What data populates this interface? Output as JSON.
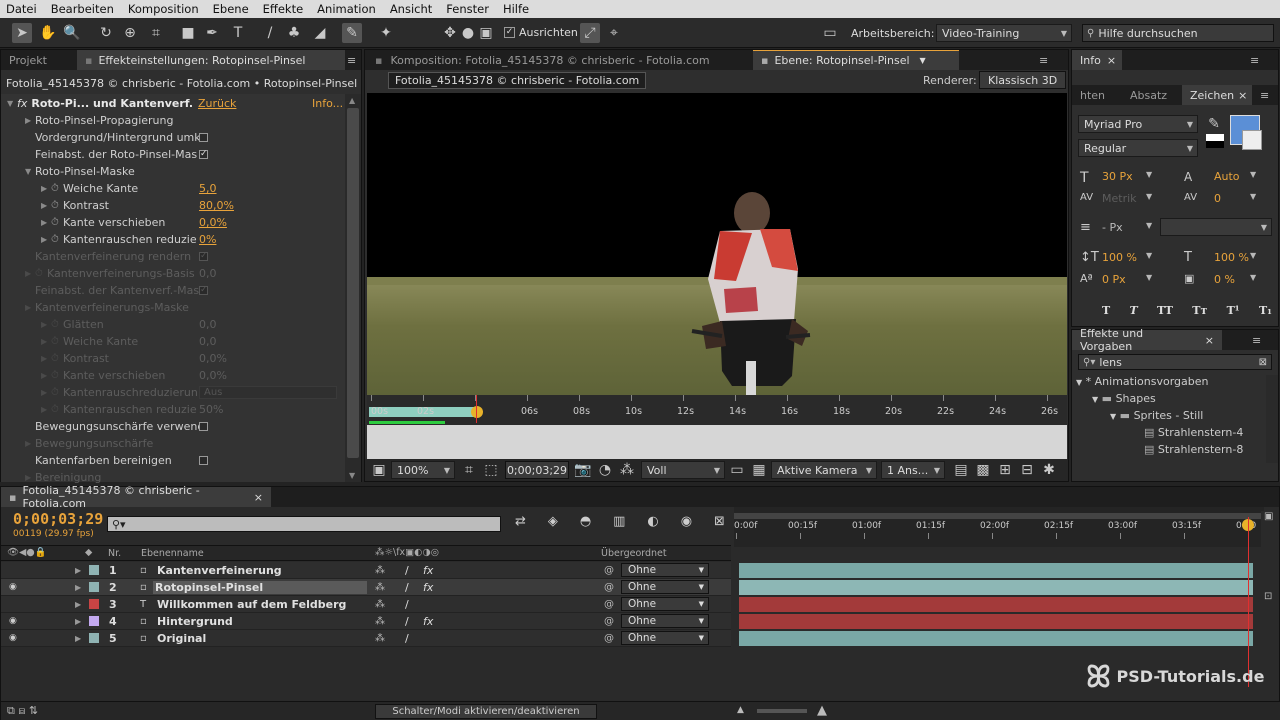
{
  "menu": [
    "Datei",
    "Bearbeiten",
    "Komposition",
    "Ebene",
    "Effekte",
    "Animation",
    "Ansicht",
    "Fenster",
    "Hilfe"
  ],
  "toolbar": {
    "ausrichten_label": "Ausrichten",
    "workspace_label": "Arbeitsbereich:",
    "workspace_value": "Video-Training",
    "help_placeholder": "Hilfe durchsuchen"
  },
  "left_panel": {
    "tab_projekt": "Projekt",
    "tab_effect": "Effekteinstellungen: Rotopinsel-Pinsel",
    "subtitle": "Fotolia_45145378 © chrisberic - Fotolia.com • Rotopinsel-Pinsel",
    "fx_name": "Roto-Pi... und Kantenverf.",
    "zurueck": "Zurück",
    "info": "Info...",
    "rows": [
      {
        "label": "Roto-Pinsel-Propagierung",
        "value": "",
        "kind": "group"
      },
      {
        "label": "Vordergrund/Hintergrund umk",
        "value": "",
        "kind": "check"
      },
      {
        "label": "Feinabst. der Roto-Pinsel-Mas",
        "value": "✓",
        "kind": "check"
      },
      {
        "label": "Roto-Pinsel-Maske",
        "value": "",
        "kind": "groupopen"
      },
      {
        "label": "Weiche Kante",
        "value": "5,0",
        "kind": "param"
      },
      {
        "label": "Kontrast",
        "value": "80,0%",
        "kind": "param"
      },
      {
        "label": "Kante verschieben",
        "value": "0,0%",
        "kind": "param"
      },
      {
        "label": "Kantenrauschen reduzie",
        "value": "0%",
        "kind": "param"
      },
      {
        "label": "Kantenverfeinerung rendern",
        "value": "✓",
        "kind": "dimcheck"
      },
      {
        "label": "Kantenverfeinerungs-Basis",
        "value": "0,0",
        "kind": "dimparam1"
      },
      {
        "label": "Feinabst. der Kantenverf.-Mas",
        "value": "✓",
        "kind": "dimcheck"
      },
      {
        "label": "Kantenverfeinerungs-Maske",
        "value": "",
        "kind": "dimgroup"
      },
      {
        "label": "Glätten",
        "value": "0,0",
        "kind": "dimparam"
      },
      {
        "label": "Weiche Kante",
        "value": "0,0",
        "kind": "dimparam"
      },
      {
        "label": "Kontrast",
        "value": "0,0%",
        "kind": "dimparam"
      },
      {
        "label": "Kante verschieben",
        "value": "0,0%",
        "kind": "dimparam"
      },
      {
        "label": "Kantenrauschreduzierun",
        "value": "Aus",
        "kind": "dimdrop"
      },
      {
        "label": "Kantenrauschen reduzie",
        "value": "50%",
        "kind": "dimparam"
      },
      {
        "label": "Bewegungsunschärfe verwend",
        "value": "",
        "kind": "check"
      },
      {
        "label": "Bewegungsunschärfe",
        "value": "",
        "kind": "dimgroup0"
      },
      {
        "label": "Kantenfarben bereinigen",
        "value": "",
        "kind": "check"
      },
      {
        "label": "Bereinigung",
        "value": "",
        "kind": "dimgroup0"
      }
    ]
  },
  "viewer": {
    "tab_comp": "Komposition: Fotolia_45145378 © chrisberic - Fotolia.com",
    "tab_layer": "Ebene: Rotopinsel-Pinsel",
    "source_label": "Fotolia_45145378 © chrisberic - Fotolia.com",
    "renderer_label": "Renderer:",
    "renderer_value": "Klassisch 3D",
    "ruler_ticks": [
      "00s",
      "02s",
      "",
      "06s",
      "08s",
      "10s",
      "12s",
      "14s",
      "16s",
      "18s",
      "20s",
      "22s",
      "24s",
      "26s"
    ],
    "zoom": "100%",
    "timecode": "0;00;03;29",
    "resolution": "Voll",
    "camera": "Aktive Kamera",
    "views": "1 Ans..."
  },
  "right_panel": {
    "tab_info": "Info",
    "tab_hten": "hten",
    "tab_absatz": "Absatz",
    "tab_zeichen": "Zeichen",
    "font": "Myriad Pro",
    "style": "Regular",
    "size": "30 Px",
    "leading": "Auto",
    "kerning": "Metrik",
    "tracking": "0",
    "stroke": "- Px",
    "vscale": "100 %",
    "hscale": "100 %",
    "baseline": "0 Px",
    "tsume": "0 %",
    "typo": [
      "T",
      "T",
      "TT",
      "Tт",
      "T¹",
      "T₁"
    ],
    "accent": "#5b8fd6",
    "effects_title": "Effekte und Vorgaben",
    "search_value": "lens",
    "tree": [
      "* Animationsvorgaben",
      "Shapes",
      "Sprites - Still",
      "Strahlenstern-4",
      "Strahlenstern-8"
    ]
  },
  "timeline": {
    "tab": "Fotolia_45145378 © chrisberic - Fotolia.com",
    "timecode": "0;00;03;29",
    "frames": "00119 (29.97 fps)",
    "col_nr": "Nr.",
    "col_name": "Ebenenname",
    "col_parent": "Übergeordnet",
    "ruler": [
      "0:00f",
      "00:15f",
      "01:00f",
      "01:15f",
      "02:00f",
      "02:15f",
      "03:00f",
      "03:15f",
      "04:0"
    ],
    "layers": [
      {
        "nr": "1",
        "name": "Kantenverfeinerung",
        "parent": "Ohne",
        "color": "#8fb3b3",
        "bar": "#7aa8a6",
        "fx": true
      },
      {
        "nr": "2",
        "name": "Rotopinsel-Pinsel",
        "parent": "Ohne",
        "color": "#8fb3b3",
        "bar": "#8db7b5",
        "fx": true
      },
      {
        "nr": "3",
        "name": "Willkommen auf dem Feldberg",
        "parent": "Ohne",
        "color": "#c84444",
        "bar": "#a33a3a",
        "fx": false
      },
      {
        "nr": "4",
        "name": "Hintergrund",
        "parent": "Ohne",
        "color": "#c3a9ef",
        "bar": "#a33a3a",
        "fx": true
      },
      {
        "nr": "5",
        "name": "Original",
        "parent": "Ohne",
        "color": "#8fb3b3",
        "bar": "#7aa8a6",
        "fx": false
      }
    ],
    "footer": "Schalter/Modi aktivieren/deaktivieren"
  },
  "watermark": "PSD-Tutorials.de"
}
